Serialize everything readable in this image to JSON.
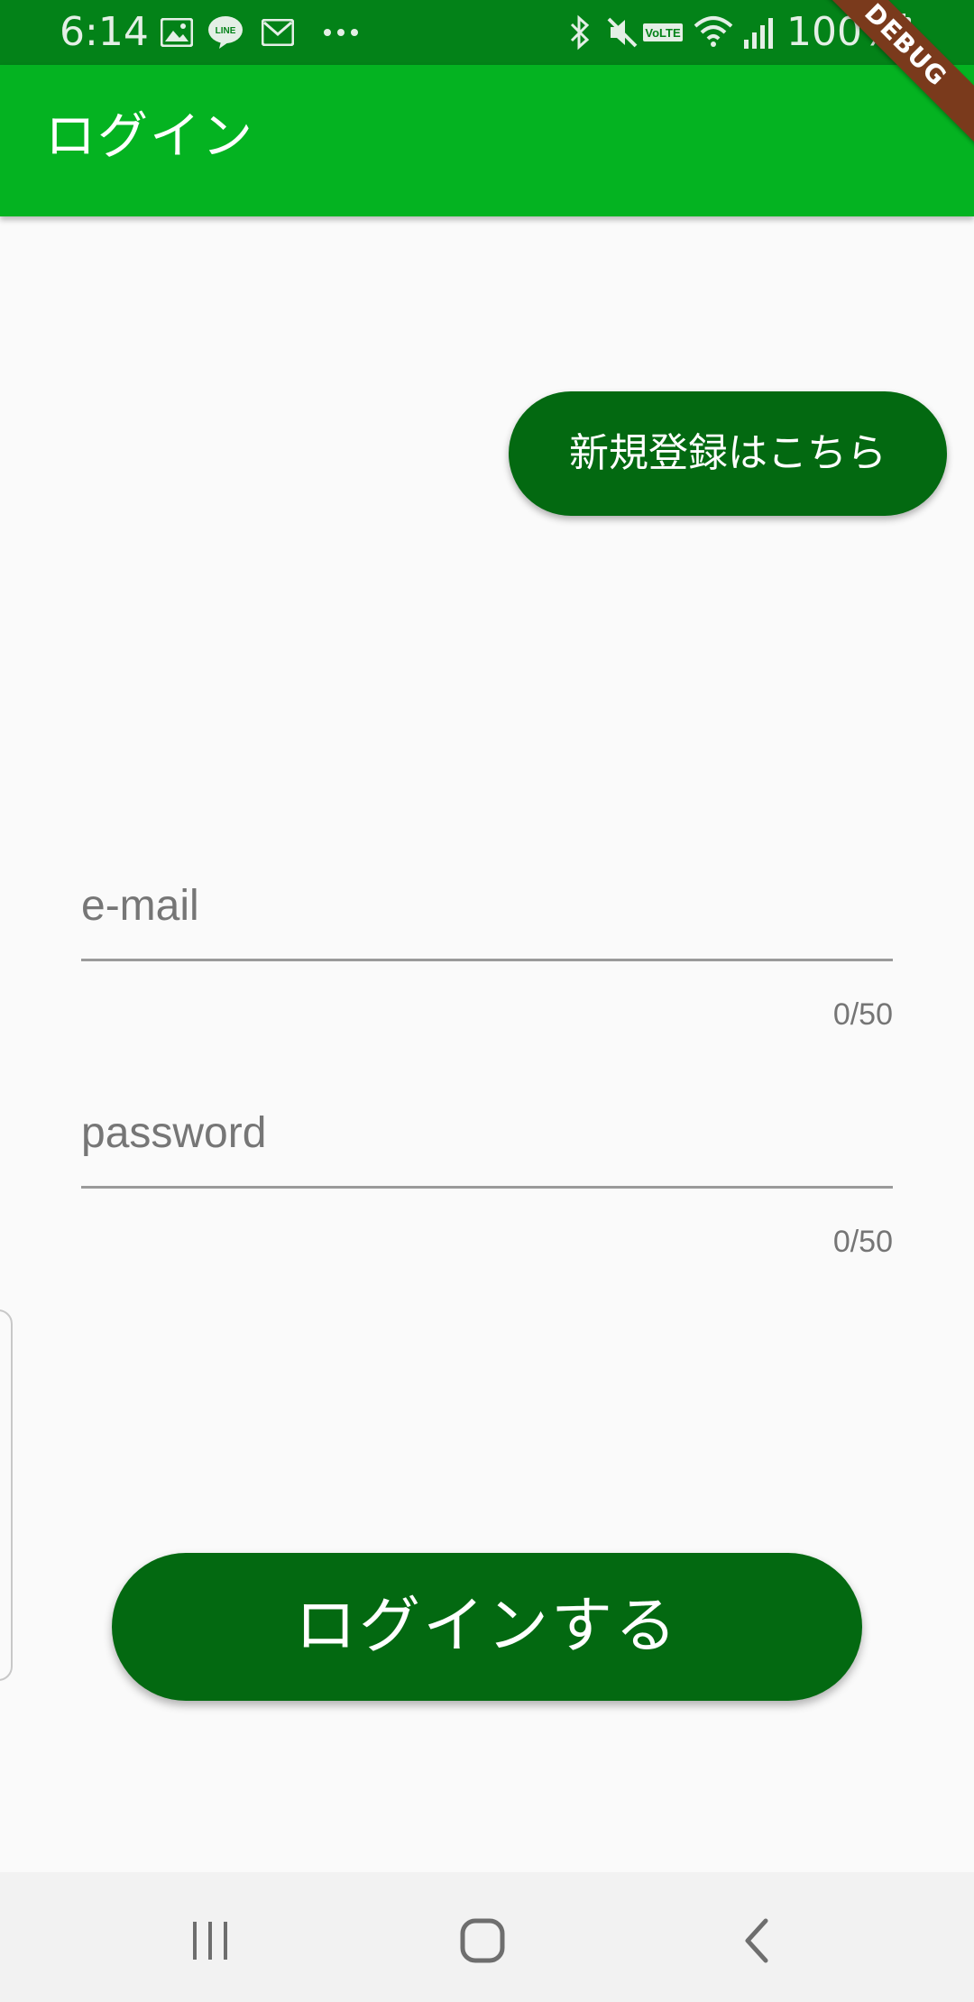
{
  "status_bar": {
    "time": "6:14",
    "battery": "100%",
    "icons": [
      "gallery-icon",
      "line-icon",
      "gmail-icon",
      "more-notifications-icon",
      "bluetooth-icon",
      "mute-icon",
      "volte-icon",
      "wifi-icon",
      "signal-icon",
      "battery-icon"
    ],
    "volte_label": "VoLTE"
  },
  "debug_banner": "DEBUG",
  "app_bar": {
    "title": "ログイン"
  },
  "register_button": {
    "label": "新規登録はこちら"
  },
  "form": {
    "email": {
      "placeholder": "e-mail",
      "value": "",
      "counter": "0/50"
    },
    "password": {
      "placeholder": "password",
      "value": "",
      "counter": "0/50"
    }
  },
  "login_button": {
    "label": "ログインする"
  },
  "nav_bar": {
    "buttons": [
      "recent-apps-icon",
      "home-icon",
      "back-icon"
    ]
  },
  "colors": {
    "status_bar": "#038218",
    "app_bar": "#04b321",
    "button": "#036911",
    "background": "#fafafa",
    "debug_banner": "#7a3a1c"
  }
}
